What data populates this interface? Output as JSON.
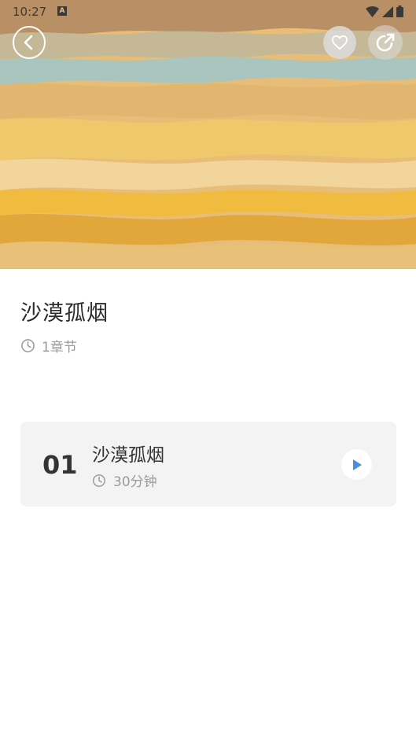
{
  "status_bar": {
    "time": "10:27",
    "notification_badge": "A",
    "icons": [
      "wifi-icon",
      "signal-icon",
      "battery-icon"
    ]
  },
  "header": {
    "back_icon": "chevron-left-icon",
    "favorite_icon": "heart-icon",
    "share_icon": "share-icon"
  },
  "album": {
    "title": "沙漠孤烟",
    "chapters": "1章节"
  },
  "tracks": [
    {
      "number": "01",
      "title": "沙漠孤烟",
      "duration": "30分钟",
      "action_icon": "play-icon"
    }
  ],
  "colors": {
    "accent": "#4a8ee0",
    "card_bg": "#f3f3f3",
    "text_primary": "#2b2b2b",
    "text_secondary": "#9a9a9a"
  }
}
